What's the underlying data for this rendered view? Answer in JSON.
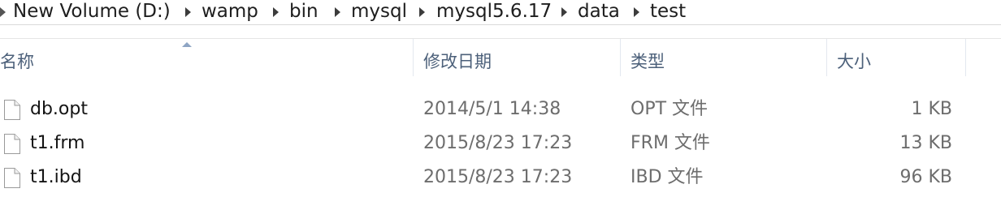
{
  "breadcrumb": {
    "items": [
      "New Volume (D:)",
      "wamp",
      "bin",
      "mysql",
      "mysql5.6.17",
      "data",
      "test"
    ]
  },
  "list": {
    "columns": {
      "name": "名称",
      "date": "修改日期",
      "type": "类型",
      "size": "大小"
    },
    "sort_column": "name",
    "sort_direction": "ascending",
    "rows": [
      {
        "name": "db.opt",
        "date": "2014/5/1 14:38",
        "type": "OPT 文件",
        "size": "1 KB",
        "icon": "file-icon"
      },
      {
        "name": "t1.frm",
        "date": "2015/8/23 17:23",
        "type": "FRM 文件",
        "size": "13 KB",
        "icon": "file-icon"
      },
      {
        "name": "t1.ibd",
        "date": "2015/8/23 17:23",
        "type": "IBD 文件",
        "size": "96 KB",
        "icon": "file-icon"
      }
    ]
  }
}
